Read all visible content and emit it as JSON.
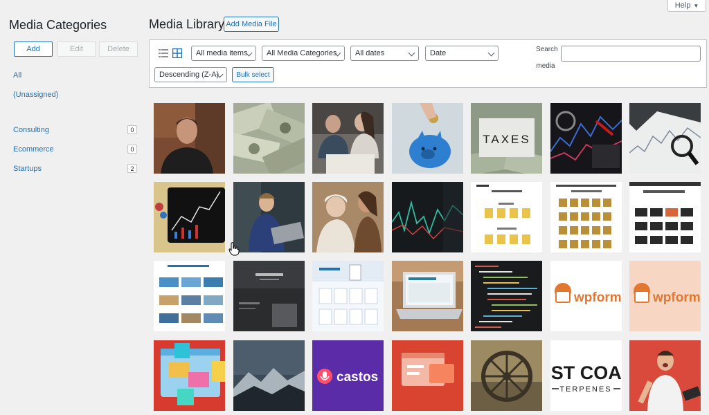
{
  "help": {
    "label": "Help",
    "caret": "▼"
  },
  "sidebar": {
    "title": "Media Categories",
    "add_label": "Add",
    "edit_label": "Edit",
    "delete_label": "Delete",
    "links": [
      {
        "label": "All"
      },
      {
        "label": "(Unassigned)"
      }
    ],
    "categories": [
      {
        "label": "Consulting",
        "count": "0"
      },
      {
        "label": "Ecommerce",
        "count": "0"
      },
      {
        "label": "Startups",
        "count": "2"
      }
    ]
  },
  "header": {
    "title": "Media Library",
    "add_button": "Add Media File"
  },
  "toolbar": {
    "filter_type": "All media items",
    "filter_category": "All Media Categories",
    "filter_date": "All dates",
    "sort_by": "Date",
    "order": "Descending (Z-A)",
    "bulk_select": "Bulk select",
    "search_label_1": "Search",
    "search_label_2": "media",
    "search_value": ""
  },
  "tiles": {
    "taxes_text": "TAXES",
    "wpforms_text": "wpforms",
    "castos_text": "castos",
    "eastcoast_line1": "AST COAS",
    "eastcoast_line2": "TERPENES"
  },
  "colors": {
    "accent": "#2271b1",
    "background": "#f0f0f1",
    "wpforms_bg": "#f7d6c4",
    "wpforms_text": "#e27730",
    "castos_bg": "#5b2ca8",
    "red_tile": "#d73b2f"
  }
}
